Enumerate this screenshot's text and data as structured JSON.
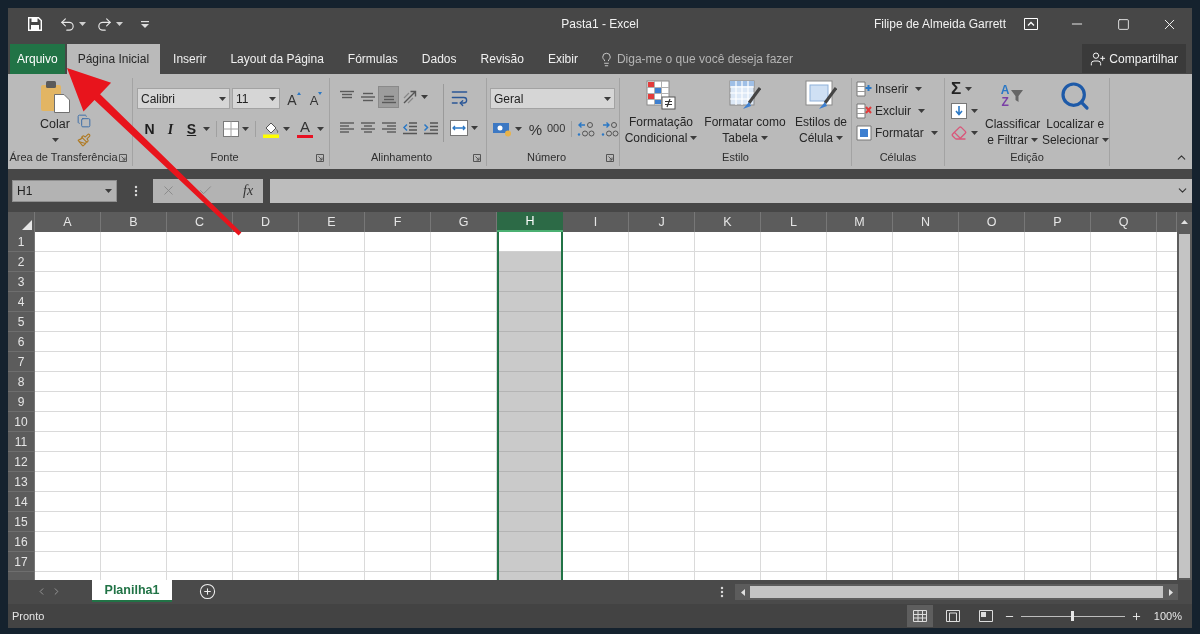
{
  "title_bar": {
    "title": "Pasta1 - Excel",
    "user": "Filipe de Almeida Garrett"
  },
  "tabs": [
    {
      "label": "Arquivo",
      "kind": "backstage",
      "selected": false
    },
    {
      "label": "Página Inicial",
      "kind": "tab",
      "selected": true
    },
    {
      "label": "Inserir",
      "kind": "tab",
      "selected": false
    },
    {
      "label": "Layout da Página",
      "kind": "tab",
      "selected": false
    },
    {
      "label": "Fórmulas",
      "kind": "tab",
      "selected": false
    },
    {
      "label": "Dados",
      "kind": "tab",
      "selected": false
    },
    {
      "label": "Revisão",
      "kind": "tab",
      "selected": false
    },
    {
      "label": "Exibir",
      "kind": "tab",
      "selected": false
    }
  ],
  "tell_me": {
    "placeholder": "Diga-me o que você deseja fazer"
  },
  "share_button": {
    "label": "Compartilhar"
  },
  "ribbon": {
    "clipboard": {
      "label": "Área de Transferência",
      "paste": "Colar"
    },
    "font": {
      "label": "Fonte",
      "font_name": "Calibri",
      "font_size": "11",
      "grow": "A",
      "shrink": "A",
      "styles": [
        {
          "kind": "bold",
          "label": "N"
        },
        {
          "kind": "italic",
          "label": "I"
        },
        {
          "kind": "underline",
          "label": "S"
        }
      ],
      "font_color": "A"
    },
    "alignment": {
      "label": "Alinhamento",
      "vertical": [
        {
          "kind": "top",
          "selected": false
        },
        {
          "kind": "middle",
          "selected": false
        },
        {
          "kind": "bottom",
          "selected": true
        }
      ],
      "horizontal": [
        {
          "kind": "left"
        },
        {
          "kind": "center"
        },
        {
          "kind": "right"
        }
      ]
    },
    "number": {
      "label": "Número",
      "format": "Geral",
      "percent": "%",
      "thousands": "000"
    },
    "styles": {
      "label": "Estilo",
      "buttons": [
        {
          "kind": "conditional",
          "lines": [
            "Formatação",
            "Condicional"
          ]
        },
        {
          "kind": "table",
          "lines": [
            "Formatar como",
            "Tabela"
          ]
        },
        {
          "kind": "cell",
          "lines": [
            "Estilos de",
            "Célula"
          ]
        }
      ]
    },
    "cells": {
      "label": "Células",
      "buttons": [
        {
          "kind": "insert",
          "label": "Inserir"
        },
        {
          "kind": "delete",
          "label": "Excluir"
        },
        {
          "kind": "format",
          "label": "Formatar"
        }
      ]
    },
    "editing": {
      "label": "Edição",
      "autosum": "Σ",
      "sort_letters": [
        "A",
        "Z"
      ],
      "sort_lines": [
        "Classificar",
        "e Filtrar"
      ],
      "find_lines": [
        "Localizar e",
        "Selecionar"
      ]
    }
  },
  "formula_bar": {
    "name_box": "H1",
    "function_button": "fx"
  },
  "sheet": {
    "columns": [
      {
        "label": "A",
        "selected": false
      },
      {
        "label": "B",
        "selected": false
      },
      {
        "label": "C",
        "selected": false
      },
      {
        "label": "D",
        "selected": false
      },
      {
        "label": "E",
        "selected": false
      },
      {
        "label": "F",
        "selected": false
      },
      {
        "label": "G",
        "selected": false
      },
      {
        "label": "H",
        "selected": true
      },
      {
        "label": "I",
        "selected": false
      },
      {
        "label": "J",
        "selected": false
      },
      {
        "label": "K",
        "selected": false
      },
      {
        "label": "L",
        "selected": false
      },
      {
        "label": "M",
        "selected": false
      },
      {
        "label": "N",
        "selected": false
      },
      {
        "label": "O",
        "selected": false
      },
      {
        "label": "P",
        "selected": false
      },
      {
        "label": "Q",
        "selected": false
      }
    ],
    "rows": [
      {
        "label": "1",
        "active": true
      },
      {
        "label": "2",
        "active": false
      },
      {
        "label": "3",
        "active": false
      },
      {
        "label": "4",
        "active": false
      },
      {
        "label": "5",
        "active": false
      },
      {
        "label": "6",
        "active": false
      },
      {
        "label": "7",
        "active": false
      },
      {
        "label": "8",
        "active": false
      },
      {
        "label": "9",
        "active": false
      },
      {
        "label": "10",
        "active": false
      },
      {
        "label": "11",
        "active": false
      },
      {
        "label": "12",
        "active": false
      },
      {
        "label": "13",
        "active": false
      },
      {
        "label": "14",
        "active": false
      },
      {
        "label": "15",
        "active": false
      },
      {
        "label": "16",
        "active": false
      },
      {
        "label": "17",
        "active": false
      }
    ]
  },
  "sheet_tabs": [
    {
      "label": "Planilha1",
      "selected": true
    }
  ],
  "status_bar": {
    "status": "Pronto",
    "views": [
      {
        "kind": "normal",
        "selected": true
      },
      {
        "kind": "page_layout",
        "selected": false
      },
      {
        "kind": "page_break",
        "selected": false
      }
    ],
    "zoom": {
      "level": 0.5,
      "reading": "100%"
    }
  }
}
